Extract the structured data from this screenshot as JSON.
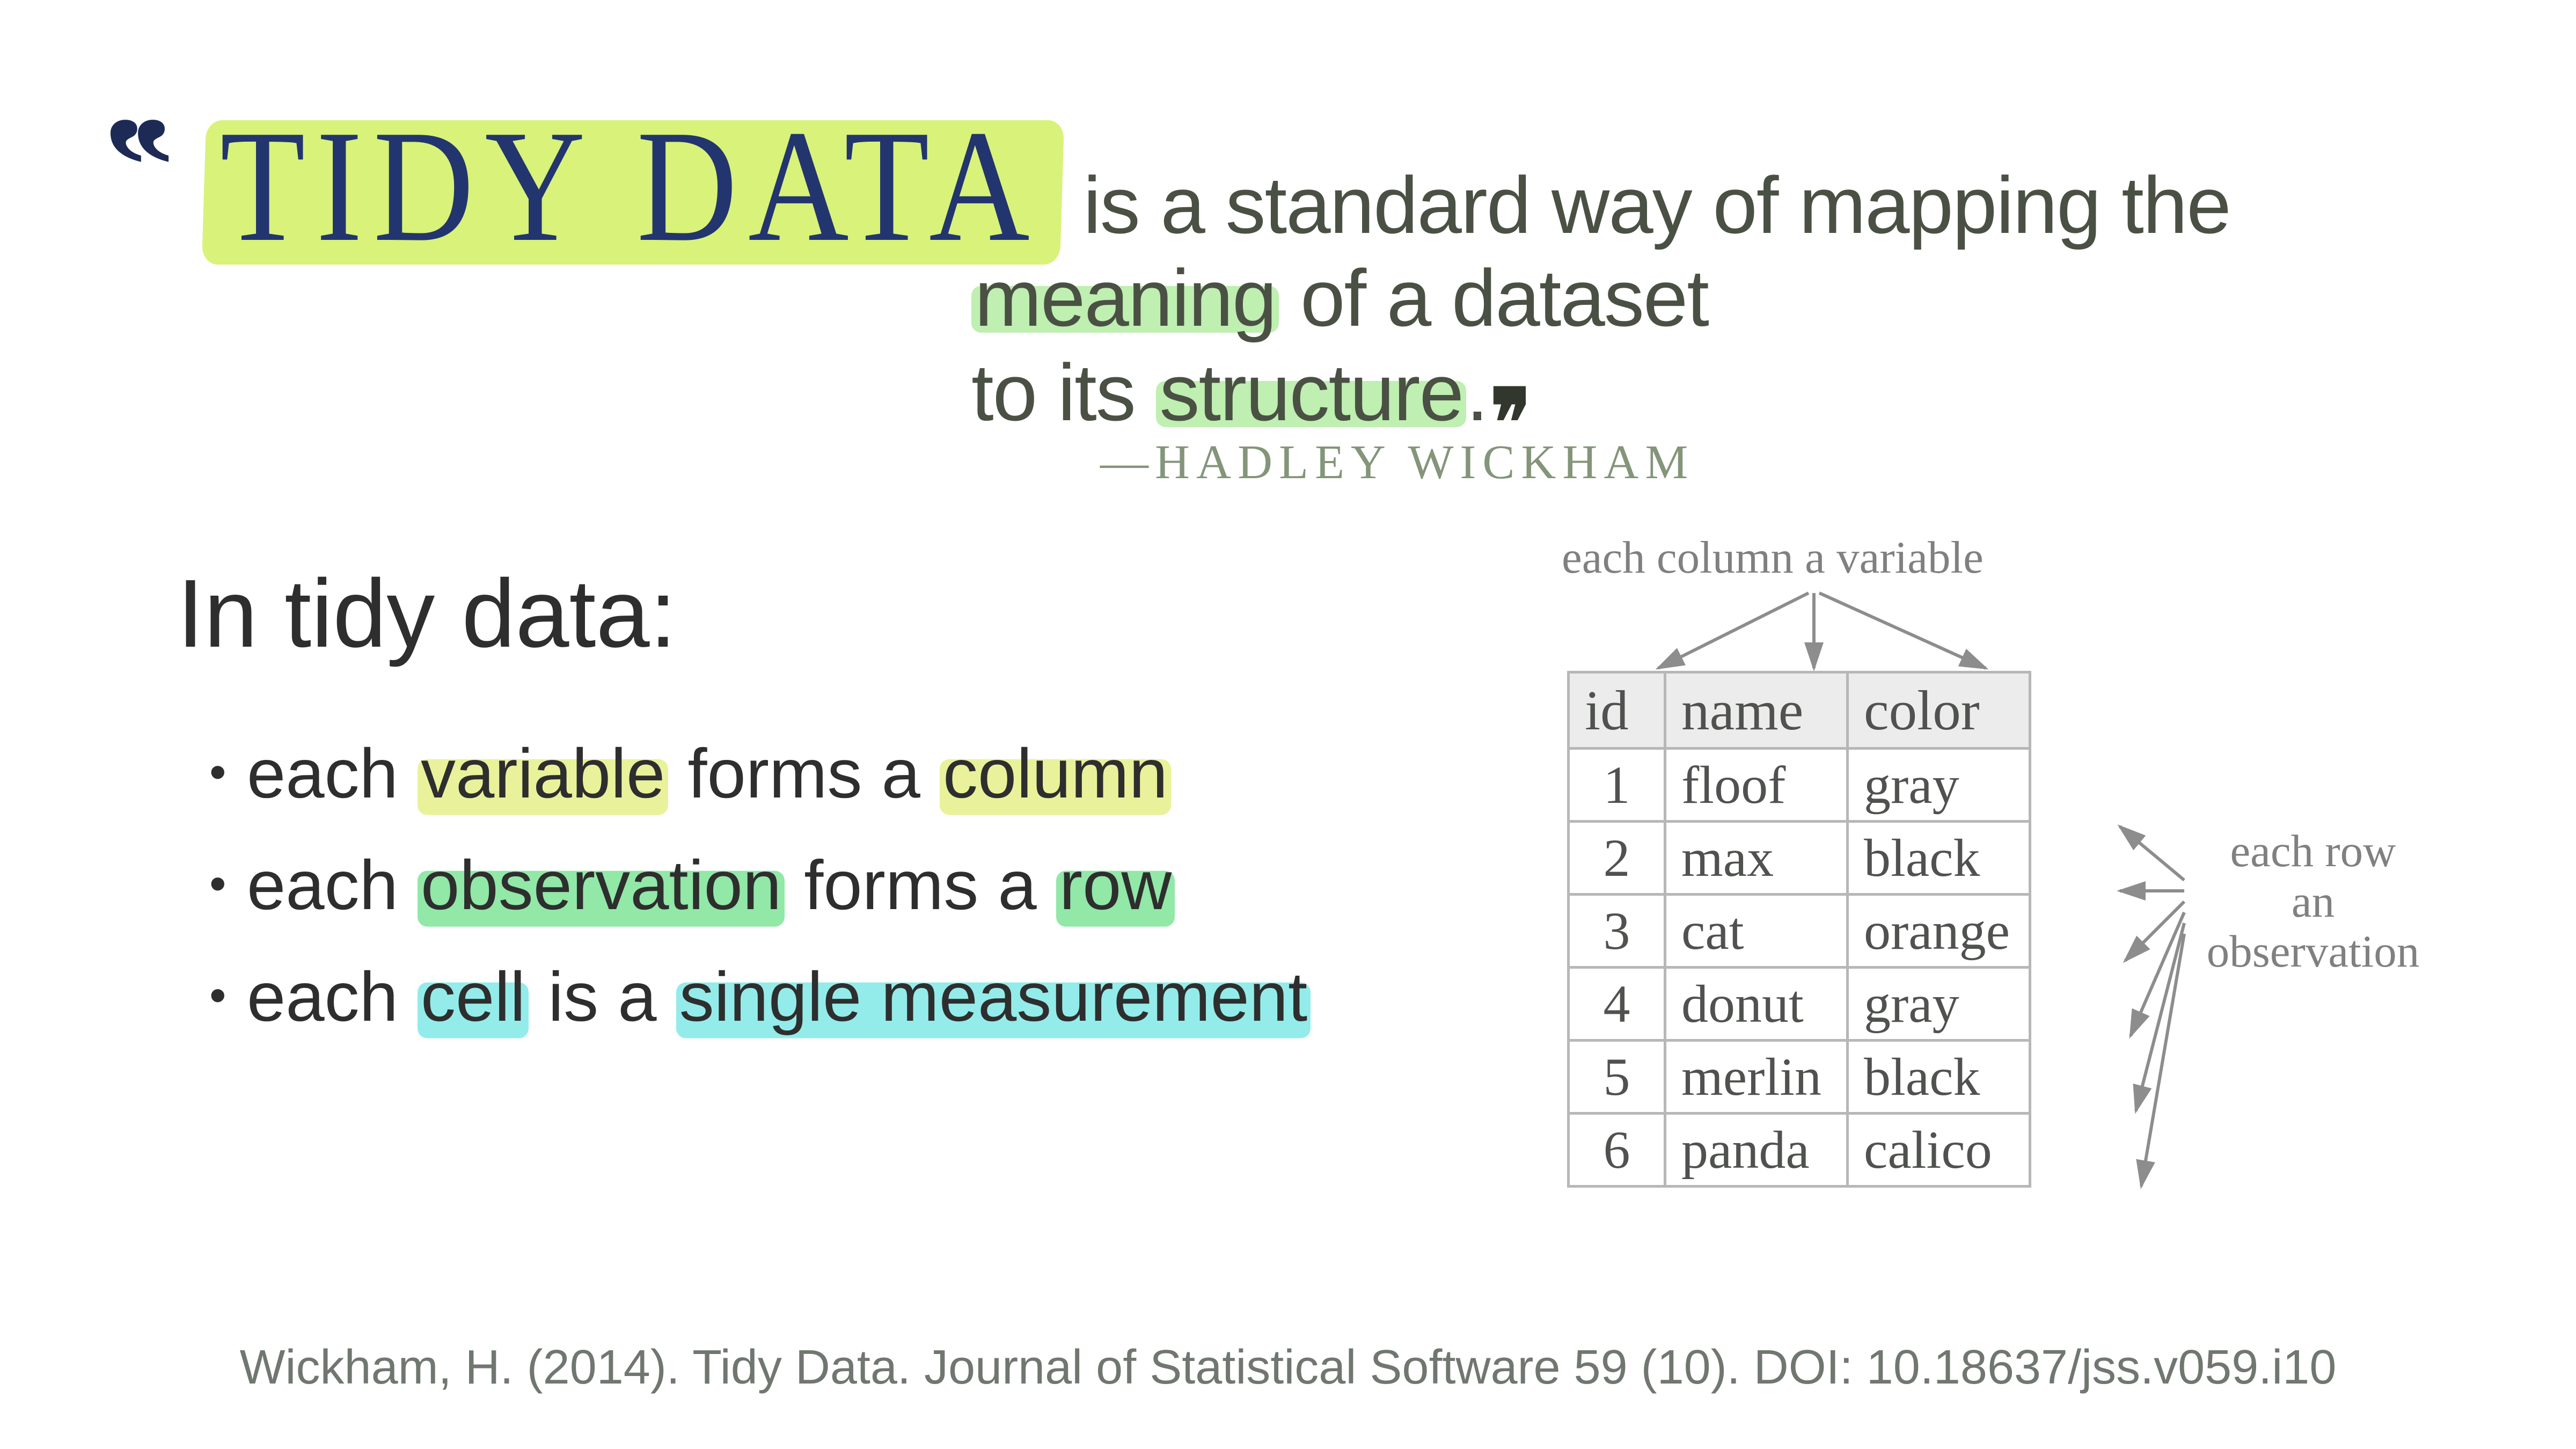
{
  "quote": {
    "title": "TIDY DATA",
    "line1_rest": " is a standard way of mapping the",
    "line2_pre": "",
    "meaning_word": "meaning",
    "line2_rest": " of a dataset",
    "line3_pre": "to its ",
    "structure_word": "structure",
    "line3_post": "."
  },
  "attribution": "—HADLEY WICKHAM",
  "section": {
    "title": "In tidy data:",
    "bullets": [
      {
        "pre": "each ",
        "em1": "variable",
        "mid": " forms a ",
        "em2": "column",
        "post": "",
        "color": "yellow"
      },
      {
        "pre": "each ",
        "em1": "observation",
        "mid": " forms a ",
        "em2": "row",
        "post": "",
        "color": "green"
      },
      {
        "pre": "each ",
        "em1": "cell",
        "mid": " is a ",
        "em2": "single measurement",
        "post": "",
        "color": "teal"
      }
    ]
  },
  "annotations": {
    "top": "each column a variable",
    "right_line1": "each row",
    "right_line2": "an",
    "right_line3": "observation"
  },
  "table": {
    "headers": [
      "id",
      "name",
      "color"
    ],
    "rows": [
      [
        "1",
        "floof",
        "gray"
      ],
      [
        "2",
        "max",
        "black"
      ],
      [
        "3",
        "cat",
        "orange"
      ],
      [
        "4",
        "donut",
        "gray"
      ],
      [
        "5",
        "merlin",
        "black"
      ],
      [
        "6",
        "panda",
        "calico"
      ]
    ]
  },
  "citation": "Wickham, H. (2014). Tidy Data. Journal of Statistical Software 59 (10). DOI: 10.18637/jss.v059.i10"
}
